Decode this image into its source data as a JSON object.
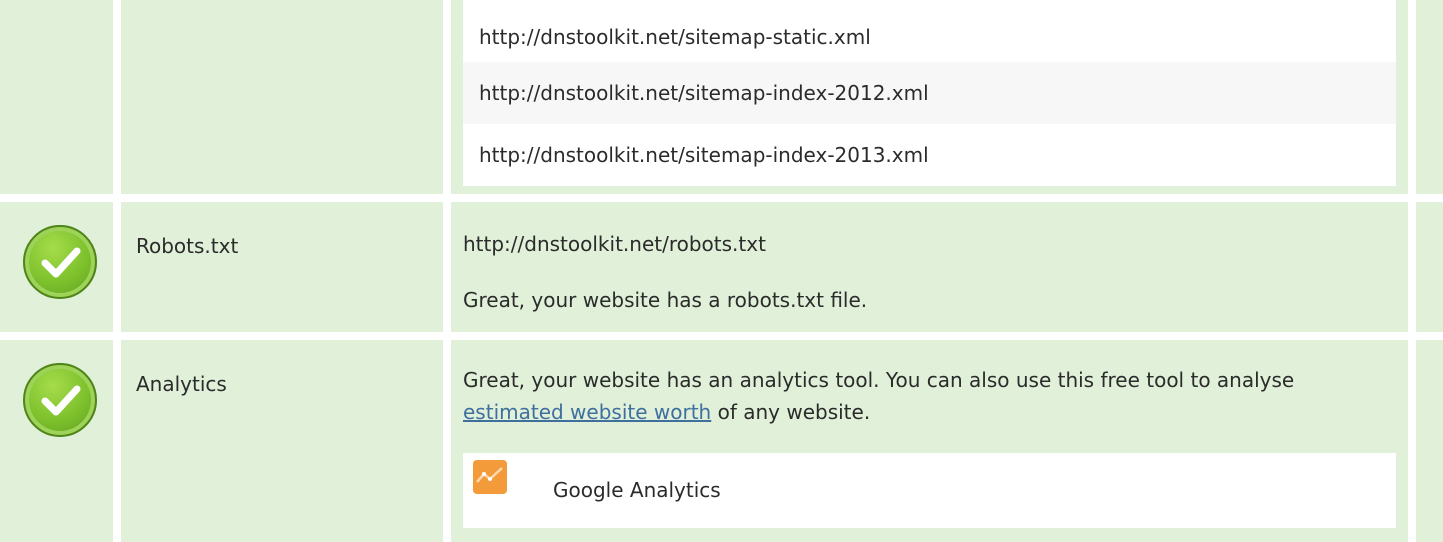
{
  "sitemaps": {
    "items": [
      "http://dnstoolkit.net/sitemap-static.xml",
      "http://dnstoolkit.net/sitemap-index-2012.xml",
      "http://dnstoolkit.net/sitemap-index-2013.xml"
    ]
  },
  "robots": {
    "label": "Robots.txt",
    "url": "http://dnstoolkit.net/robots.txt",
    "message": "Great, your website has a robots.txt file."
  },
  "analytics": {
    "label": "Analytics",
    "message_before": "Great, your website has an analytics tool. You can also use this free tool to analyse ",
    "link_text": "estimated website worth",
    "message_after": " of any website.",
    "tool_name": "Google Analytics"
  },
  "icons": {
    "status": "checkmark-circle-icon",
    "analytics_tool": "google-analytics-icon"
  },
  "colors": {
    "row_bg": "#e0f0d9",
    "success_green": "#7cc02c",
    "link": "#3f6f9f",
    "analytics_orange": "#f39a3a"
  }
}
